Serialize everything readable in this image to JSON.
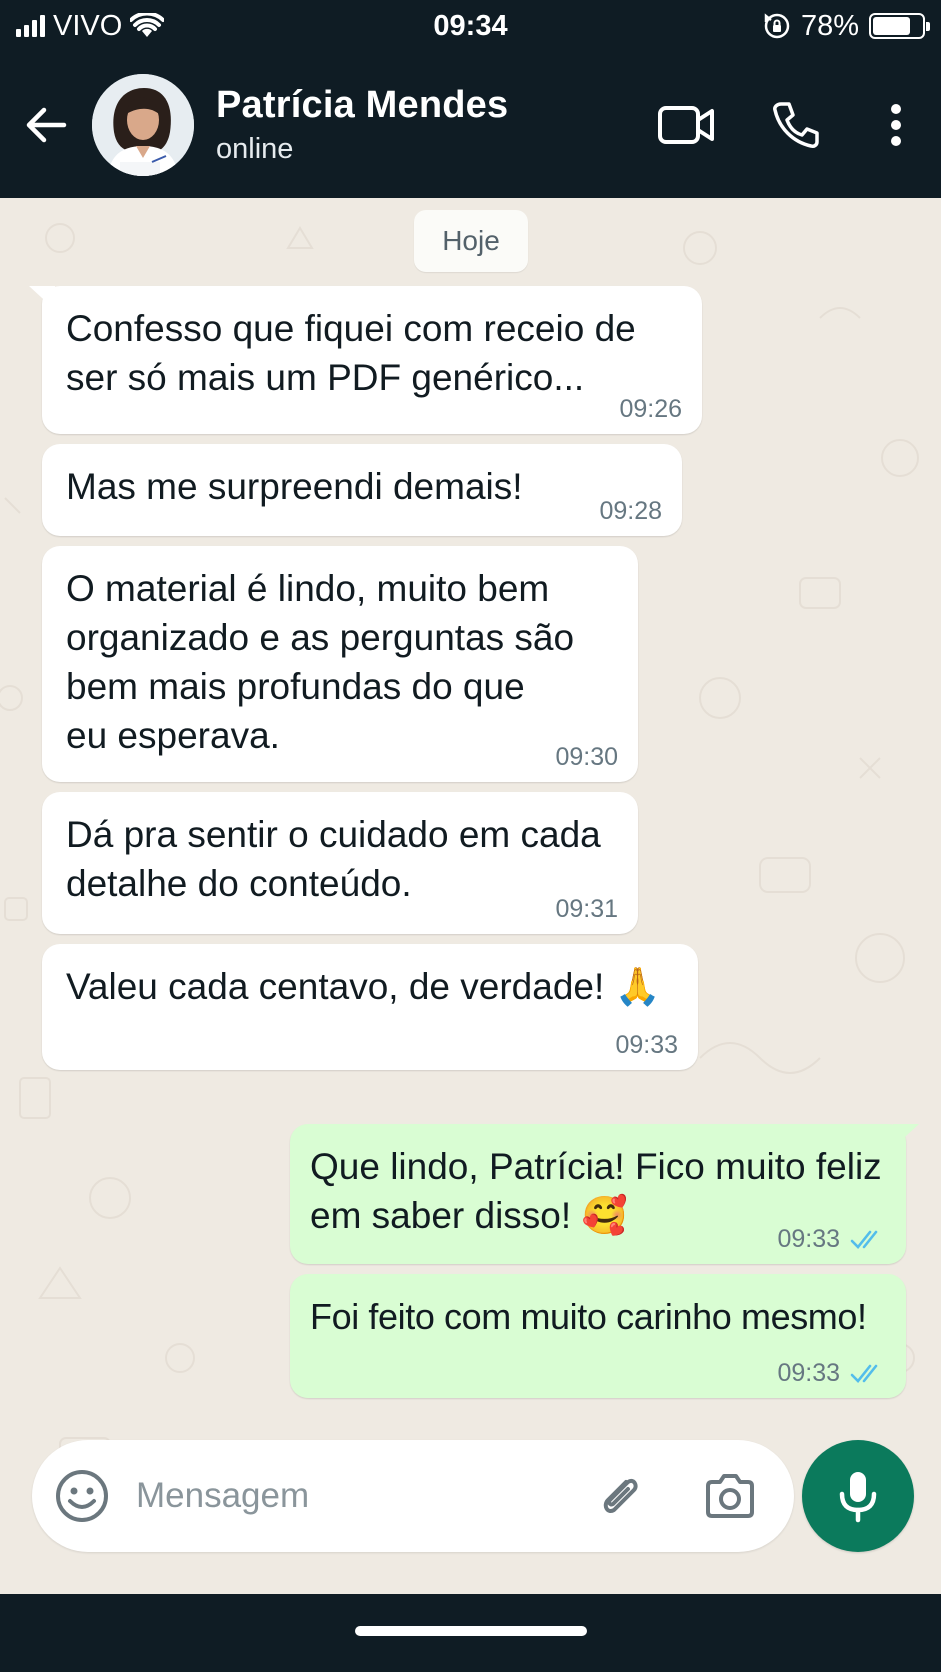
{
  "status_bar": {
    "carrier": "VIVO",
    "time": "09:34",
    "battery": "78%",
    "battery_level": 0.78,
    "icons": [
      "signal-icon",
      "wifi-icon",
      "rotation-lock-icon",
      "battery-icon"
    ]
  },
  "header": {
    "contact_name": "Patrícia Mendes",
    "contact_status": "online",
    "icons": [
      "back-arrow-icon",
      "video-call-icon",
      "phone-icon",
      "more-vert-icon"
    ]
  },
  "chat": {
    "date_label": "Hoje",
    "messages": [
      {
        "direction": "in",
        "text": "Confesso que fiquei com receio de\nser só mais um PDF genérico...",
        "time": "09:26"
      },
      {
        "direction": "in",
        "text": "Mas me surpreendi demais!",
        "time": "09:28"
      },
      {
        "direction": "in",
        "text": "O material é lindo, muito bem\norganizado e as perguntas são\nbem mais profundas do que\neu esperava.",
        "time": "09:30"
      },
      {
        "direction": "in",
        "text": "Dá pra sentir o cuidado em cada\ndetalhe do conteúdo.",
        "time": "09:31"
      },
      {
        "direction": "in",
        "text": "Valeu cada centavo, de verdade! 🙏",
        "time": "09:33"
      },
      {
        "direction": "out",
        "text": "Que lindo, Patrícia! Fico muito feliz\nem saber disso! 🥰",
        "time": "09:33",
        "status": "read"
      },
      {
        "direction": "out",
        "text": "Foi feito com muito carinho mesmo!",
        "time": "09:33",
        "status": "read"
      }
    ]
  },
  "composer": {
    "placeholder": "Mensagem",
    "icons": [
      "emoji-icon",
      "attach-icon",
      "camera-icon",
      "mic-icon"
    ]
  },
  "colors": {
    "header_bg": "#0f1c24",
    "chat_bg": "#efeae2",
    "incoming_bubble": "#ffffff",
    "outgoing_bubble": "#d9fdd3",
    "read_ticks": "#53bdeb",
    "mic_button": "#0b7a5c"
  }
}
